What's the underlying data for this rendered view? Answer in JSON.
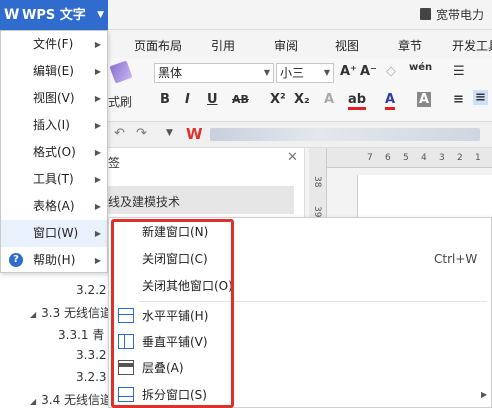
{
  "titlebar": {
    "app_name": "WPS 文字",
    "logo": "W",
    "cloud_text": "宽带电力"
  },
  "tabs": [
    "页面布局",
    "引用",
    "审阅",
    "视图",
    "章节",
    "开发工具"
  ],
  "ribbon": {
    "format_painter": "式刷",
    "font_name": "黑体",
    "font_size": "小三"
  },
  "navigation": {
    "header": "签",
    "items": [
      "线及建模技术",
      "3.2.2",
      "3.3 无线信道",
      "3.3.1 青",
      "3.3.2",
      "3.2.3",
      "3.4 无线信道"
    ]
  },
  "file_menu": {
    "items": [
      {
        "label": "文件(F)"
      },
      {
        "label": "编辑(E)"
      },
      {
        "label": "视图(V)"
      },
      {
        "label": "插入(I)"
      },
      {
        "label": "格式(O)"
      },
      {
        "label": "工具(T)"
      },
      {
        "label": "表格(A)"
      },
      {
        "label": "窗口(W)"
      },
      {
        "label": "帮助(H)"
      }
    ]
  },
  "window_menu": {
    "items": [
      {
        "label": "新建窗口(N)",
        "shortcut": ""
      },
      {
        "label": "关闭窗口(C)",
        "shortcut": "Ctrl+W"
      },
      {
        "label": "关闭其他窗口(O)",
        "shortcut": ""
      },
      {
        "label": "水平平铺(H)",
        "shortcut": ""
      },
      {
        "label": "垂直平铺(V)",
        "shortcut": ""
      },
      {
        "label": "层叠(A)",
        "shortcut": ""
      },
      {
        "label": "拆分窗口(S)",
        "shortcut": ""
      }
    ]
  },
  "ruler": {
    "top_ticks": [
      "7",
      "6",
      "5",
      "4",
      "3",
      "2",
      "1"
    ],
    "side_ticks": [
      "38",
      "39",
      "40"
    ]
  },
  "colors": {
    "accent": "#2f6cce",
    "highlight_box": "#e0302b"
  }
}
